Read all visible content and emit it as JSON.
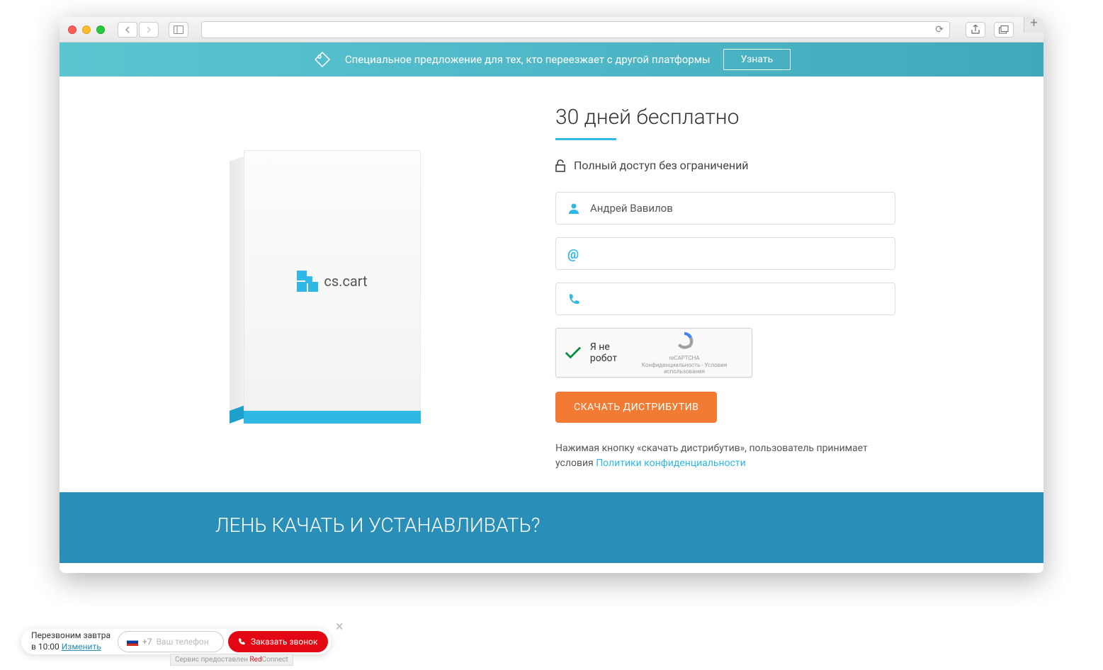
{
  "promo": {
    "text": "Специальное предложение для тех, кто переезжает с другой платформы",
    "button": "Узнать"
  },
  "logo": {
    "text": "cs.cart"
  },
  "form": {
    "heading": "30 дней бесплатно",
    "access": "Полный доступ без ограничений",
    "name_value": "Андрей Вавилов",
    "email_value": "",
    "phone_value": "",
    "captcha_label": "Я не робот",
    "captcha_brand": "reCAPTCHA",
    "captcha_terms": "Конфиденциальность - Условия использования",
    "download_button": "СКАЧАТЬ ДИСТРИБУТИВ",
    "legal_prefix": "Нажимая кнопку «скачать дистрибутив», пользователь принимает условия ",
    "legal_link": "Политики конфиденциальности"
  },
  "bluesection": {
    "heading": "ЛЕНЬ КАЧАТЬ И УСТАНАВЛИВАТЬ?"
  },
  "callback": {
    "line1": "Перезвоним завтра",
    "line2_prefix": "в 10:00 ",
    "change": "Изменить",
    "phone_prefix": "+7",
    "phone_placeholder": "Ваш телефон",
    "button": "Заказать звонок",
    "credit_prefix": "Сервис предоставлен ",
    "credit_brand1": "Red",
    "credit_brand2": "Connect"
  }
}
